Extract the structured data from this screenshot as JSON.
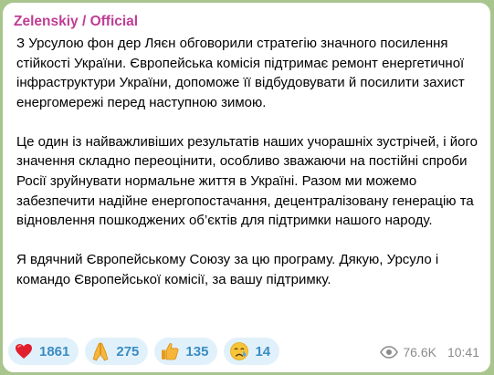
{
  "message": {
    "channel_name": "Zelenskiy / Official",
    "paragraphs": [
      "З Урсулою фон дер Ляєн обговорили стратегію значного посилення стійкості України. Європейська комісія підтримає ремонт енергетичної інфраструктури України, допоможе її відбудовувати й посилити захист енергомережі перед наступною зимою.",
      "Це один із найважливіших результатів наших учорашніх зустрічей, і його значення складно переоцінити, особливо зважаючи на постійні спроби Росії зруйнувати нормальне життя в Україні. Разом ми можемо забезпечити надійне енергопостачання, децентралізовану генерацію та відновлення пошкоджених об’єктів для підтримки нашого народу.",
      "Я вдячний Європейському Союзу за цю програму. Дякую, Урсуло і командо Європейської комісії, за вашу підтримку."
    ],
    "reactions": [
      {
        "icon": "red-heart-icon",
        "count": "1861"
      },
      {
        "icon": "folded-hands-icon",
        "count": "275"
      },
      {
        "icon": "thumbs-up-icon",
        "count": "135"
      },
      {
        "icon": "crying-face-icon",
        "count": "14"
      }
    ],
    "views": "76.6K",
    "time": "10:41",
    "colors": {
      "channel_name": "#c03d94",
      "reaction_bg": "#e1f1fb",
      "reaction_count": "#3a8cc4",
      "meta": "#8b8b8b",
      "background": "#a9c58e"
    }
  }
}
